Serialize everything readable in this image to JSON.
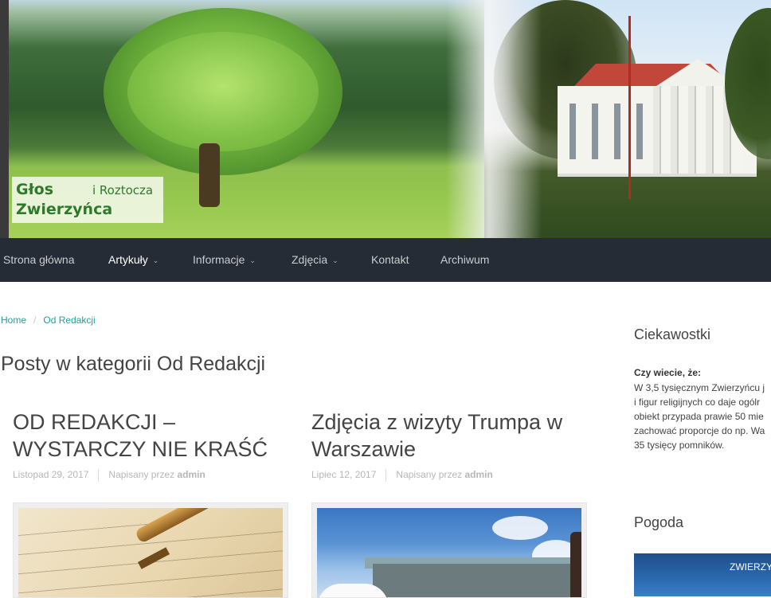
{
  "header": {
    "logo_line1": "Głos",
    "logo_line1_suffix": "i Roztocza",
    "logo_line2": "Zwierzyńca"
  },
  "nav": {
    "items": [
      {
        "label": "Strona główna",
        "dropdown": false,
        "active": false
      },
      {
        "label": "Artykuły",
        "dropdown": true,
        "active": true
      },
      {
        "label": "Informacje",
        "dropdown": true,
        "active": false
      },
      {
        "label": "Zdjęcia",
        "dropdown": true,
        "active": false
      },
      {
        "label": "Kontakt",
        "dropdown": false,
        "active": false
      },
      {
        "label": "Archiwum",
        "dropdown": false,
        "active": false
      }
    ],
    "chevron": "⌄"
  },
  "breadcrumb": {
    "home": "Home",
    "separator": "/",
    "current": "Od Redakcji"
  },
  "page_title": "Posty w kategorii Od Redakcji",
  "posts": [
    {
      "title": "OD REDAKCJI – WYSTARCZY NIE KRAŚĆ",
      "date": "Listopad 29, 2017",
      "author_prefix": "Napisany przez",
      "author": "admin",
      "thumbnail": "fountain-pen-letter-image"
    },
    {
      "title": "Zdjęcia z wizyty Trumpa w Warszawie",
      "date": "Lipiec 12, 2017",
      "author_prefix": "Napisany przez",
      "author": "admin",
      "thumbnail": "warsaw-visit-image"
    }
  ],
  "sidebar": {
    "widget1_title": "Ciekawostki",
    "fact_heading": "Czy wiecie, że:",
    "fact_text": "W 3,5 tysięcznym Zwierzyńcu j\ni figur religijnych co daje ogólr\nobiekt przypada prawie 50 mie\nzachować proporcje do np. Wa\n35 tysięcy pomników.",
    "widget2_title": "Pogoda",
    "weather_label": "ZWIERZY"
  },
  "colors": {
    "nav_bg": "#262c35",
    "link_teal": "#1fa398",
    "logo_green": "#2f7a2a"
  }
}
